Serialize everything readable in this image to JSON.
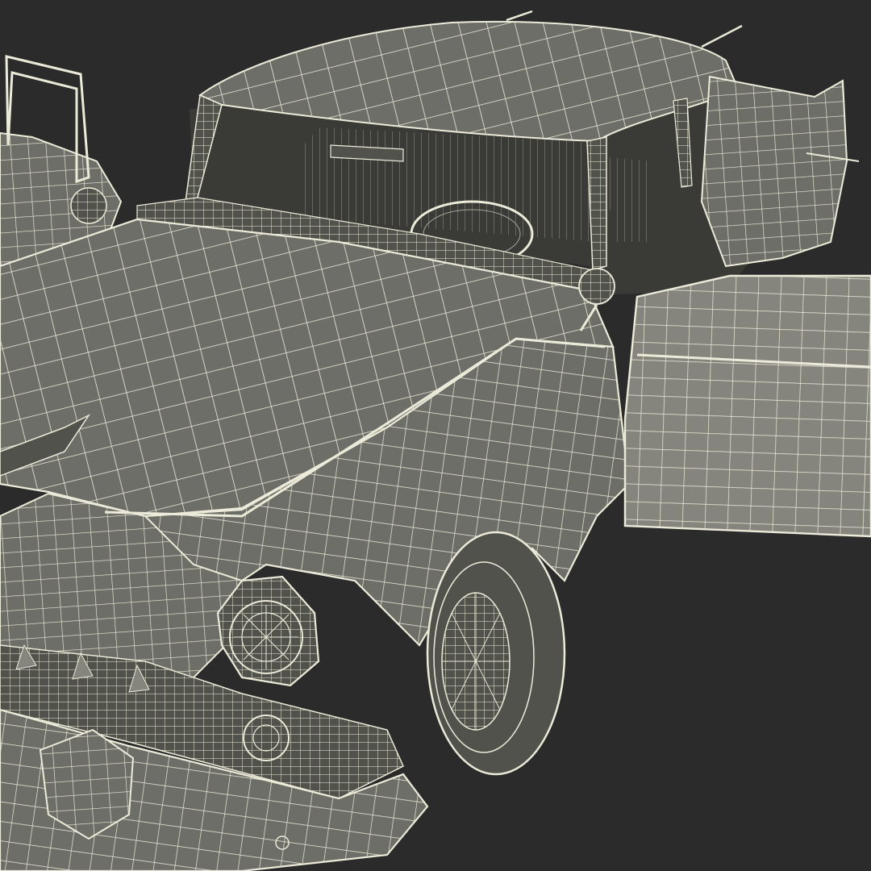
{
  "scene": {
    "subject": "car-wireframe-render",
    "colors": {
      "background": "#2b2b2b",
      "surface": "#6e6e68",
      "surface_dark": "#52524d",
      "surface_light": "#85857e",
      "wire": "#ecebd9",
      "cavity": "#3a3a37"
    }
  }
}
